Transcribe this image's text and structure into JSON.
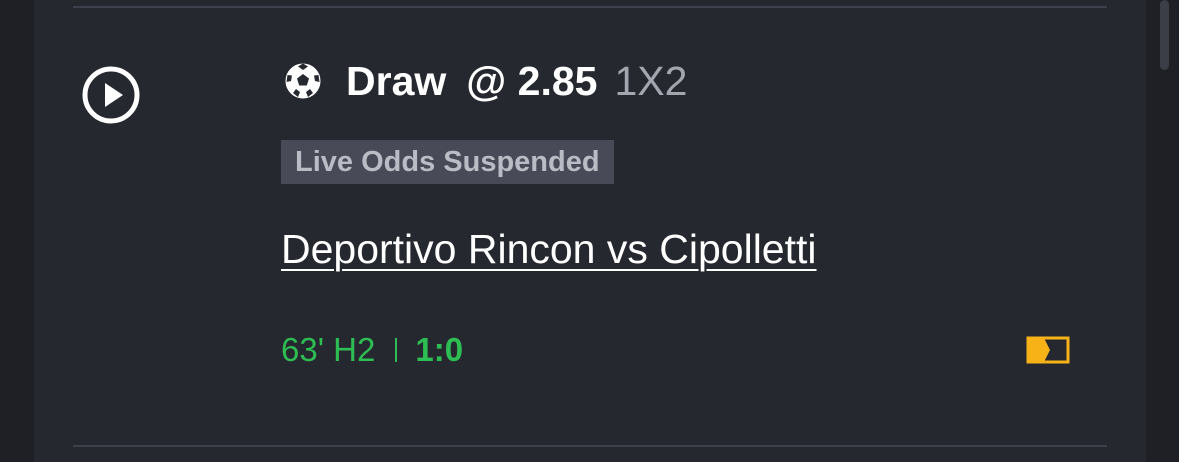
{
  "bet": {
    "sport_icon": "soccer-ball-icon",
    "selection": "Draw",
    "odds": "@ 2.85",
    "market": "1X2",
    "status_badge": "Live Odds Suspended"
  },
  "match": {
    "name": "Deportivo Rincon vs Cipolletti",
    "clock": "63' H2",
    "score": "1:0"
  },
  "icons": {
    "play": "play-circle-icon",
    "flag": "live-stream-flag-icon"
  },
  "colors": {
    "live_green": "#2ebd53",
    "flag_yellow": "#f7b217",
    "badge_bg": "#484b57"
  }
}
